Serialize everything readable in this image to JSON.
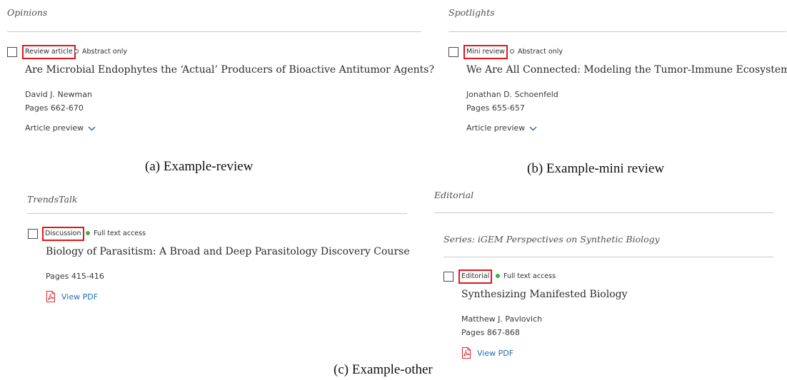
{
  "panels": {
    "review": {
      "heading": "Opinions",
      "badge": "Review article",
      "access": "Abstract only",
      "title": "Are Microbial Endophytes the ‘Actual’ Producers of Bioactive Antitumor Agents?",
      "author": "David J. Newman",
      "pages": "Pages 662-670",
      "preview": "Article preview"
    },
    "mini": {
      "heading": "Spotlights",
      "badge": "Mini review",
      "access": "Abstract only",
      "title": "We Are All Connected: Modeling the Tumor-Immune Ecosystem",
      "author": "Jonathan D. Schoenfeld",
      "pages": "Pages 655-657",
      "preview": "Article preview"
    },
    "discussion": {
      "heading": "TrendsTalk",
      "badge": "Discussion",
      "access": "Full text access",
      "title": "Biology of Parasitism: A Broad and Deep Parasitology Discovery Course",
      "pages": "Pages 415-416",
      "pdf": "View PDF"
    },
    "editorial": {
      "heading": "Editorial",
      "series": "Series: iGEM Perspectives on Synthetic Biology",
      "badge": "Editorial",
      "access": "Full text access",
      "title": "Synthesizing Manifested Biology",
      "author": "Matthew J. Pavlovich",
      "pages": "Pages 867-868",
      "pdf": "View PDF"
    }
  },
  "captions": {
    "a": "(a) Example-review",
    "b": "(b) Example-mini review",
    "c": "(c) Example-other"
  },
  "colors": {
    "highlight_box": "#e0161b",
    "full_access_dot": "#3fae49",
    "link": "#1f6fb2",
    "chevron": "#1f6fb2",
    "pdf_icon": "#e0262b"
  },
  "icons": {
    "checkbox": "checkbox-square",
    "chevron": "chevron-down-icon",
    "pdf": "pdf-file-icon",
    "abstract_only": "open-circle-icon",
    "full_text": "green-dot-icon"
  }
}
